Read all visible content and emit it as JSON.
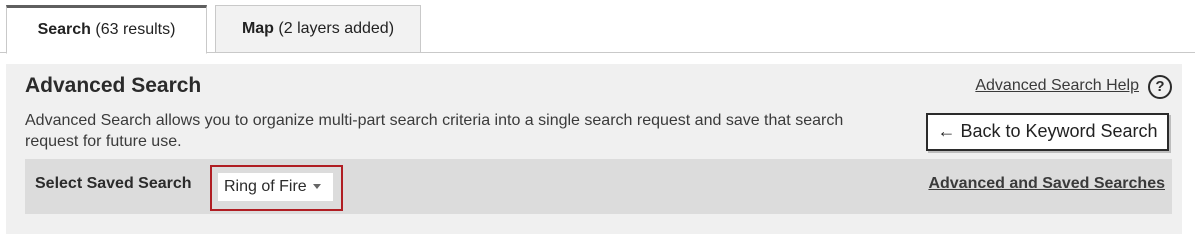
{
  "tabs": [
    {
      "label": "Search",
      "detail": "(63 results)",
      "active": true
    },
    {
      "label": "Map",
      "detail": "(2 layers added)",
      "active": false
    }
  ],
  "panel": {
    "title": "Advanced Search",
    "help_link": "Advanced Search Help",
    "help_icon": "?",
    "description": "Advanced Search allows you to organize multi-part search criteria into a single search request and save that search request for future use.",
    "back_button": "← Back to Keyword Search",
    "saved_search": {
      "label": "Select Saved Search",
      "selected": "Ring of Fire",
      "link": "Advanced and Saved Searches"
    }
  },
  "colors": {
    "highlight_border": "#b01e23",
    "panel_bg": "#f0f0f0",
    "saved_row_bg": "#dcdcdc"
  }
}
